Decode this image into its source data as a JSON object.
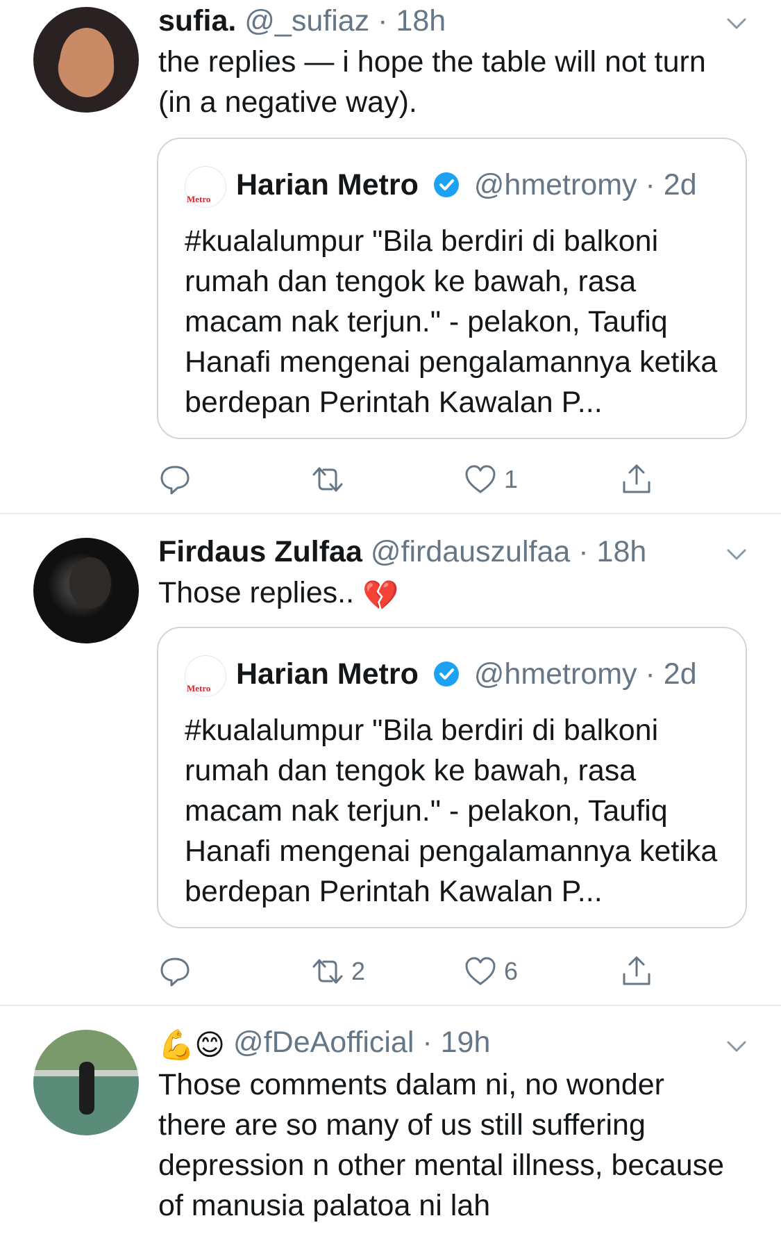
{
  "tweets": [
    {
      "name": "sufia.",
      "handle": "@_sufiaz",
      "dot": "·",
      "time": "18h",
      "text": "the replies — i hope the table will not turn (in a negative way).",
      "quote": {
        "name": "Harian Metro",
        "handle": "@hmetromy",
        "dot": "·",
        "time": "2d",
        "logo": "Metro",
        "text": "#kualalumpur \"Bila berdiri di balkoni rumah dan tengok ke bawah, rasa macam nak terjun.\" - pelakon, Taufiq Hanafi mengenai pengalamannya ketika berdepan Perintah Kawalan P..."
      },
      "actions": {
        "reply": "",
        "retweet": "",
        "like": "1"
      }
    },
    {
      "name": "Firdaus Zulfaa",
      "handle": "@firdauszulfaa",
      "dot": "·",
      "time": "18h",
      "text": "Those replies..",
      "text_emoji": "💔",
      "quote": {
        "name": "Harian Metro",
        "handle": "@hmetromy",
        "dot": "·",
        "time": "2d",
        "logo": "Metro",
        "text": "#kualalumpur \"Bila berdiri di balkoni rumah dan tengok ke bawah, rasa macam nak terjun.\" - pelakon, Taufiq Hanafi mengenai pengalamannya ketika berdepan Perintah Kawalan P..."
      },
      "actions": {
        "reply": "",
        "retweet": "2",
        "like": "6"
      }
    },
    {
      "name_emoji": "💪😊",
      "handle": "@fDeAofficial",
      "dot": "·",
      "time": "19h",
      "text": "Those comments dalam ni, no wonder there are so many of us still suffering depression n other mental illness, because of manusia palatoa ni lah"
    }
  ],
  "icons": [
    "chevron-down-icon",
    "verified-badge-icon",
    "reply-icon",
    "retweet-icon",
    "like-icon",
    "share-icon"
  ],
  "colors": {
    "secondary_text": "#657786",
    "verified_blue": "#1da1f2",
    "border": "#ccd6dd"
  }
}
